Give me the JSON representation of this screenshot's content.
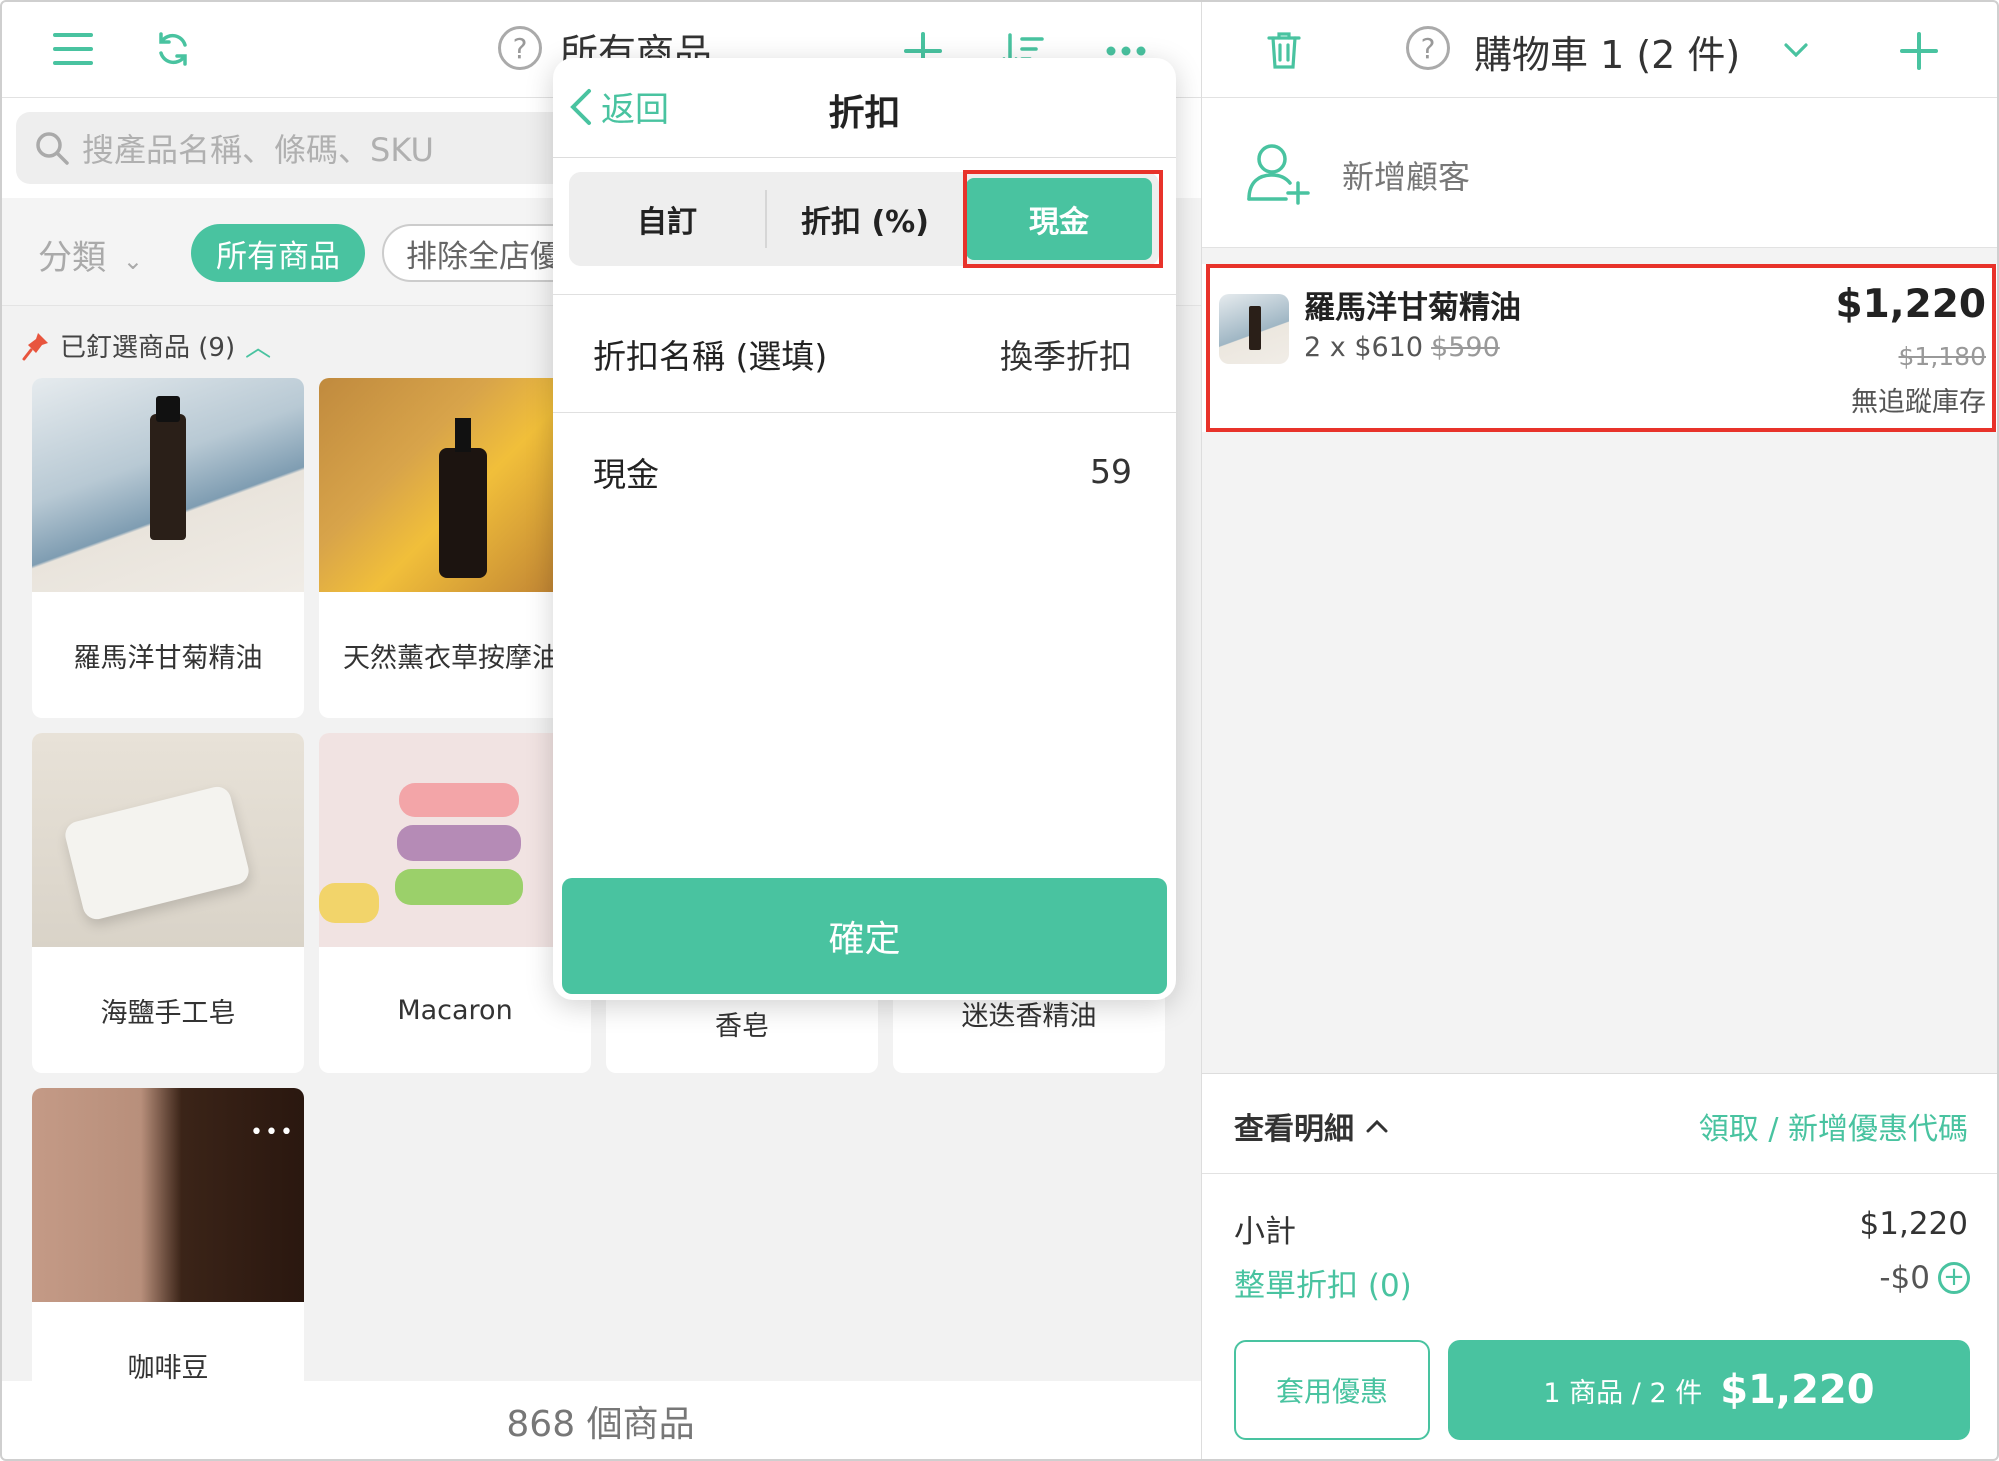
{
  "left": {
    "title": "所有商品",
    "search_placeholder": "搜產品名稱、條碼、SKU",
    "category_dropdown": "分類",
    "chips": [
      "所有商品",
      "排除全店優"
    ],
    "pinned_label": "已釘選商品 (9)",
    "products": [
      {
        "name": "羅馬洋甘菊精油"
      },
      {
        "name": "天然薰衣草按摩油"
      },
      {
        "name": "海鹽手工皂"
      },
      {
        "name": "Macaron"
      },
      {
        "name": "香皂"
      },
      {
        "name": "迷迭香精油"
      },
      {
        "name": "咖啡豆"
      }
    ],
    "footer": "868 個商品"
  },
  "popover": {
    "back_label": "返回",
    "title": "折扣",
    "tabs": [
      "自訂",
      "折扣 (%)",
      "現金"
    ],
    "active_tab": "現金",
    "name_label": "折扣名稱 (選填)",
    "name_value": "換季折扣",
    "amount_label": "現金",
    "amount_value": "59",
    "confirm_label": "確定"
  },
  "cart": {
    "title": "購物車 1 (2 件)",
    "add_customer": "新增顧客",
    "item": {
      "name": "羅馬洋甘菊精油",
      "qty_text": "2 x $610",
      "orig_unit": "$590",
      "total": "$1,220",
      "orig_total": "$1,180",
      "stock": "無追蹤庫存"
    },
    "view_details": "查看明細",
    "coupon_link": "領取 / 新增優惠代碼",
    "subtotal_label": "小計",
    "subtotal_value": "$1,220",
    "order_discount_label": "整單折扣 (0)",
    "order_discount_value": "-$0",
    "apply_label": "套用優惠",
    "checkout_count": "1 商品 / 2 件",
    "checkout_amount": "$1,220"
  },
  "colors": {
    "accent": "#49c3a0",
    "highlight": "#e8322a"
  }
}
